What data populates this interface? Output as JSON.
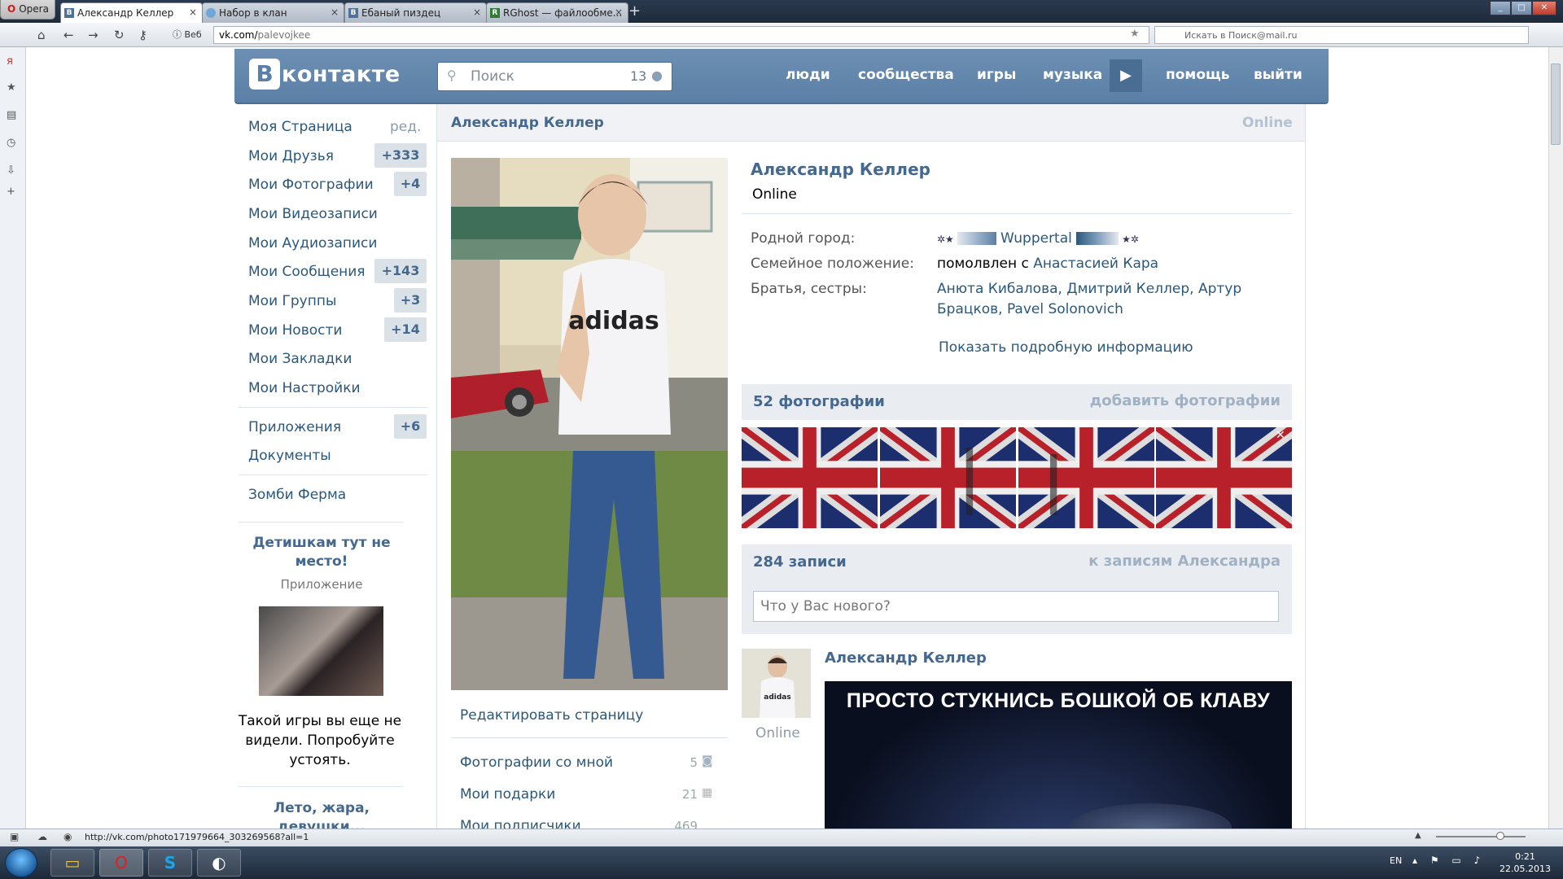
{
  "browser": {
    "menu_label": "Opera",
    "tabs": [
      {
        "label": "Александр Келлер",
        "favicon": "В"
      },
      {
        "label": "Набор в клан",
        "favicon": "globe"
      },
      {
        "label": "Ебаный пиздец",
        "favicon": "В"
      },
      {
        "label": "RGhost — файлообме...",
        "favicon": "R"
      }
    ],
    "new_tab": "+",
    "web_badge": "Веб",
    "url_host": "vk.com/",
    "url_path": "palevojkee",
    "search_placeholder": "Искать в Поиск@mail.ru",
    "status_url": "http://vk.com/photo171979664_303269568?all=1"
  },
  "vk": {
    "logo_mark": "В",
    "logo_text": "контакте",
    "search_placeholder": "Поиск",
    "search_count": "13",
    "nav": [
      "люди",
      "сообщества",
      "игры",
      "музыка",
      "помощь",
      "выйти"
    ],
    "left_menu": [
      {
        "label": "Моя Страница",
        "badge": ""
      },
      {
        "label": "Мои Друзья",
        "badge": "+333"
      },
      {
        "label": "Мои Фотографии",
        "badge": "+4"
      },
      {
        "label": "Мои Видеозаписи",
        "badge": ""
      },
      {
        "label": "Мои Аудиозаписи",
        "badge": ""
      },
      {
        "label": "Мои Сообщения",
        "badge": "+143"
      },
      {
        "label": "Мои Группы",
        "badge": "+3"
      },
      {
        "label": "Мои Новости",
        "badge": "+14"
      },
      {
        "label": "Мои Закладки",
        "badge": ""
      },
      {
        "label": "Мои Настройки",
        "badge": ""
      },
      {
        "label": "Приложения",
        "badge": "+6"
      },
      {
        "label": "Документы",
        "badge": ""
      },
      {
        "label": "Зомби Ферма",
        "badge": ""
      }
    ],
    "edit_label": "ред.",
    "promo1": {
      "title": "Детишкам тут не место!",
      "subtitle": "Приложение",
      "text": "Такой игры вы еще не видели. Попробуйте устоять."
    },
    "promo2_title": "Лето, жара, девушки..."
  },
  "profile": {
    "header_name": "Александр Келлер",
    "header_status": "Online",
    "name": "Александр Келлер",
    "status": "Online",
    "fields": [
      {
        "label": "Родной город:",
        "value": "Wuppertal"
      },
      {
        "label": "Семейное положение:",
        "value_prefix": "помолвлен с",
        "value_link": "Анастасией Кара"
      },
      {
        "label": "Братья, сестры:",
        "value_line1": "Анюта Кибалова, Дмитрий Келлер, Артур",
        "value_line2": "Брацков, Pavel Solonovich"
      }
    ],
    "show_more": "Показать подробную информацию",
    "edit_page": "Редактировать страницу",
    "side_links": [
      {
        "label": "Фотографии со мной",
        "count": "5"
      },
      {
        "label": "Мои подарки",
        "count": "21"
      },
      {
        "label": "Мои подписчики",
        "count": "469"
      }
    ],
    "photos_title": "52 фотографии",
    "photos_action": "добавить фотографии",
    "wall_title": "284 записи",
    "wall_action": "к записям Александра",
    "post_placeholder": "Что у Вас нового?",
    "post": {
      "author": "Александр Келлер",
      "author_status": "Online",
      "image_caption": "ПРОСТО СТУКНИСЬ БОШКОЙ ОБ КЛАВУ"
    }
  },
  "system": {
    "lang": "EN",
    "time": "0:21",
    "date": "22.05.2013"
  }
}
